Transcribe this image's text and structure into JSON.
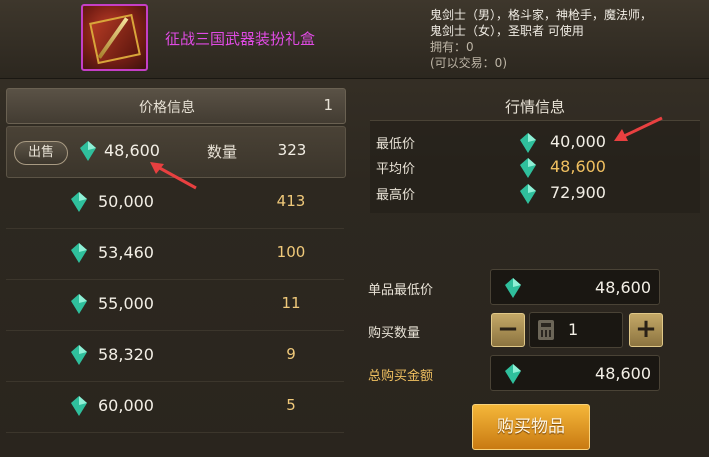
{
  "item": {
    "name": "征战三国武器装扮礼盒",
    "classes_line1": "鬼剑士（男），格斗家，神枪手，魔法师，",
    "classes_line2": "鬼剑士（女），圣职者 可使用",
    "owned": "拥有：0",
    "tradable": "(可以交易：0)"
  },
  "price_panel": {
    "title": "价格信息",
    "page": "1",
    "sell_label": "出售",
    "qty_label": "数量",
    "rows": [
      {
        "price": "48,600",
        "qty": "323"
      },
      {
        "price": "50,000",
        "qty": "413"
      },
      {
        "price": "53,460",
        "qty": "100"
      },
      {
        "price": "55,000",
        "qty": "11"
      },
      {
        "price": "58,320",
        "qty": "9"
      },
      {
        "price": "60,000",
        "qty": "5"
      }
    ]
  },
  "market": {
    "title": "行情信息",
    "min_label": "最低价",
    "min_value": "40,000",
    "avg_label": "平均价",
    "avg_value": "48,600",
    "max_label": "最高价",
    "max_value": "72,900"
  },
  "buy": {
    "unit_min_label": "单品最低价",
    "unit_min_value": "48,600",
    "qty_label": "购买数量",
    "qty_value": "1",
    "minus": "−",
    "plus": "+",
    "total_label": "总购买金额",
    "total_value": "48,600",
    "button": "购买物品"
  },
  "colors": {
    "gem": "#33c9a8",
    "item_name": "#e04be4",
    "accent_gold": "#f0c060",
    "arrow": "#e84040"
  }
}
